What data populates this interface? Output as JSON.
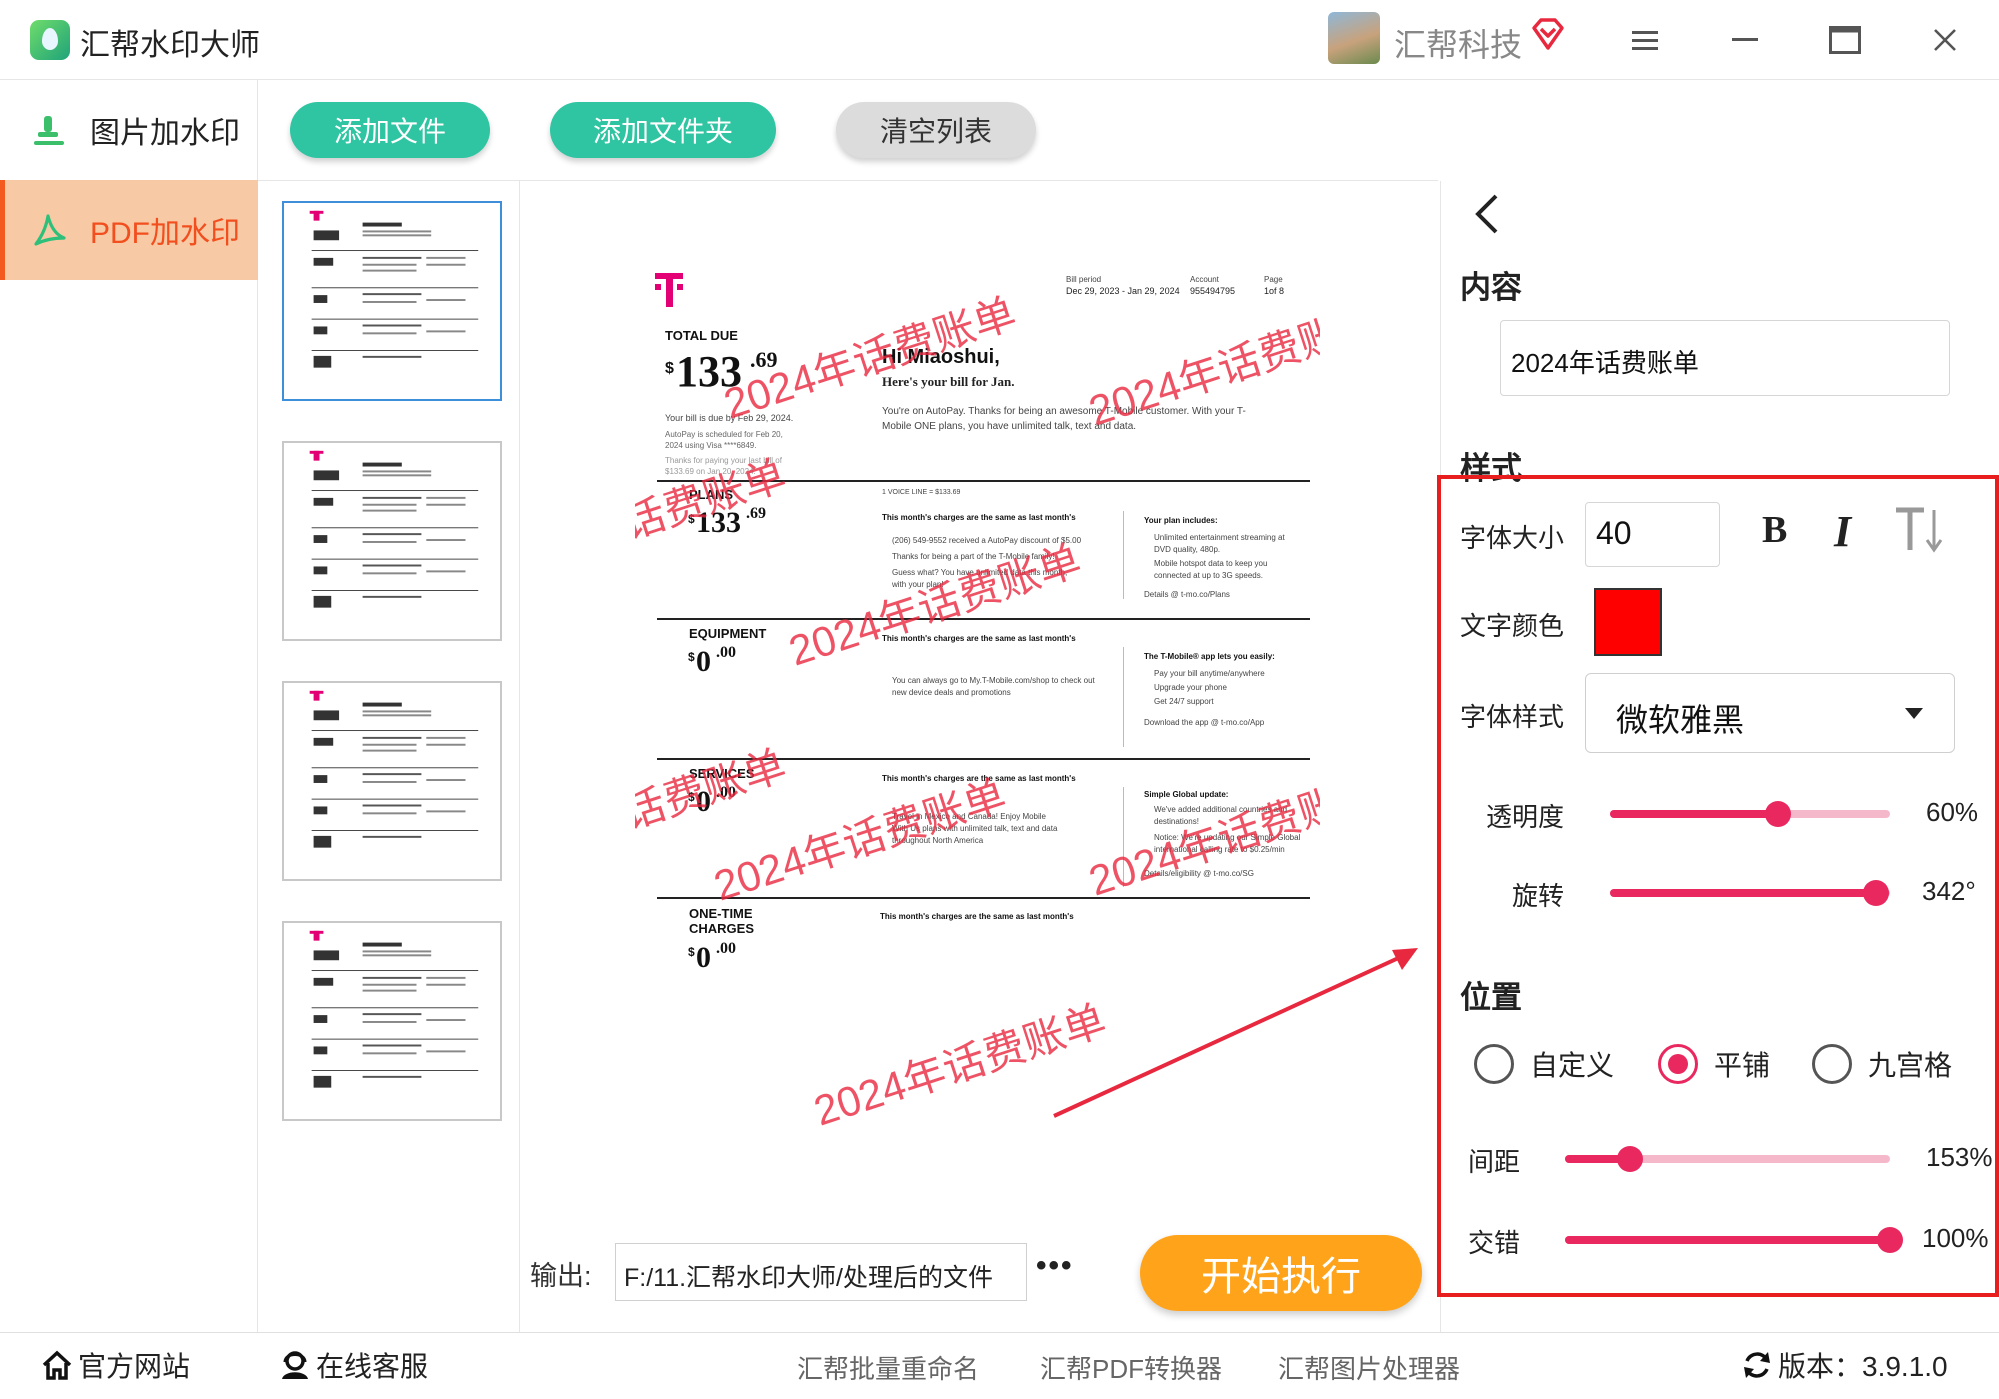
{
  "app": {
    "title": "汇帮水印大师",
    "user_name": "汇帮科技"
  },
  "sidebar": {
    "items": [
      {
        "label": "图片加水印",
        "icon": "stamp-icon"
      },
      {
        "label": "PDF加水印",
        "icon": "pdf-icon"
      }
    ],
    "active": "PDF加水印"
  },
  "toolbar": {
    "add_file": "添加文件",
    "add_folder": "添加文件夹",
    "clear_list": "清空列表"
  },
  "preview": {
    "watermark_text": "2024年话费账单",
    "watermark_partial": "单",
    "doc": {
      "header": {
        "bill_period_label": "Bill period",
        "bill_period": "Dec 29, 2023 - Jan 29, 2024",
        "account_label": "Account",
        "account": "955494795",
        "page_label": "Page",
        "page": "1of 8"
      },
      "total_due_label": "TOTAL DUE",
      "total_due_int": "133",
      "total_due_cents": ".69",
      "due_note": "Your bill is due by Feb 29, 2024.",
      "autopay_note_1": "AutoPay is scheduled for Feb 20,",
      "autopay_note_2": "2024 using Visa ****6849.",
      "thanks_note_1": "Thanks for paying your last bill of",
      "thanks_note_2": "$133.69 on Jan 20, 2024.",
      "greeting": "Hi Miaoshui,",
      "subgreeting": "Here's your bill for Jan.",
      "intro_1": "You're on AutoPay. Thanks for being an awesome T-Mobile customer. With your T-",
      "intro_2": "Mobile ONE plans, you have unlimited talk, text and data.",
      "sections": [
        {
          "name": "PLANS",
          "amount_int": "133",
          "amount_cents": ".69",
          "line_note": "1 VOICE LINE = $133.69",
          "heading": "This month's charges are the same as last month's",
          "bullets": [
            "(206) 549-9552 received a AutoPay discount of $5.00",
            "Thanks for being a part of the T-Mobile family!",
            "Guess what? You have unlimited data this month,",
            "with your plan!"
          ],
          "side_title": "Your plan includes:",
          "side_bullets": [
            "Unlimited entertainment streaming at",
            "DVD quality, 480p.",
            "Mobile hotspot data to keep you",
            "connected at up to 3G speeds."
          ],
          "side_footer": "Details @ t-mo.co/Plans"
        },
        {
          "name": "EQUIPMENT",
          "amount_int": "0",
          "amount_cents": ".00",
          "heading": "This month's charges are the same as last month's",
          "bullets": [
            "You can always go to My.T-Mobile.com/shop to check out",
            "new device deals and promotions"
          ],
          "side_title": "The T-Mobile® app lets you easily:",
          "side_bullets": [
            "Pay your bill anytime/anywhere",
            "Upgrade your phone",
            "Get 24/7 support"
          ],
          "side_footer": "Download the app @ t-mo.co/App"
        },
        {
          "name": "SERVICES",
          "amount_int": "0",
          "amount_cents": ".00",
          "heading": "This month's charges are the same as last month's",
          "bullets": [
            "Travel in Mexico and Canada! Enjoy Mobile",
            "With Us plans with unlimited talk, text and data",
            "throughout North America"
          ],
          "side_title": "Simple Global update:",
          "side_bullets": [
            "We've added additional countries and",
            "destinations!",
            "Notice: We're updating our Simple Global",
            "international calling rate to $0.25/min"
          ],
          "side_footer": "Details/eligibility @ t-mo.co/SG"
        },
        {
          "name_1": "ONE-TIME",
          "name_2": "CHARGES",
          "amount_int": "0",
          "amount_cents": ".00",
          "heading": "This month's charges are the same as last month's"
        }
      ]
    }
  },
  "output": {
    "label": "输出:",
    "path": "F:/11.汇帮水印大师/处理后的文件",
    "more": "•••",
    "start": "开始执行"
  },
  "panel": {
    "content_title": "内容",
    "content_value": "2024年话费账单",
    "style_title": "样式",
    "font_size_label": "字体大小",
    "font_size_value": "40",
    "bold": "B",
    "italic": "I",
    "text_color_label": "文字颜色",
    "text_color": "#ff0000",
    "font_style_label": "字体样式",
    "font_style_value": "微软雅黑",
    "opacity_label": "透明度",
    "opacity_value": "60%",
    "opacity_fraction": 0.6,
    "rotate_label": "旋转",
    "rotate_value": "342°",
    "rotate_fraction": 0.95,
    "position_title": "位置",
    "position_options": [
      "自定义",
      "平铺",
      "九宫格"
    ],
    "position_selected": "平铺",
    "spacing_label": "间距",
    "spacing_value": "153%",
    "spacing_fraction": 0.2,
    "stagger_label": "交错",
    "stagger_value": "100%",
    "stagger_fraction": 1.0
  },
  "footer": {
    "site": "官方网站",
    "service": "在线客服",
    "rename": "汇帮批量重命名",
    "pdf": "汇帮PDF转换器",
    "image": "汇帮图片处理器",
    "version": "版本：3.9.1.0"
  },
  "colors": {
    "accent_green": "#2fc5a2",
    "accent_orange": "#ffa31a",
    "slider_pink": "#e8285e",
    "highlight_red": "#e81e1e",
    "tmobile_magenta": "#e20074"
  }
}
